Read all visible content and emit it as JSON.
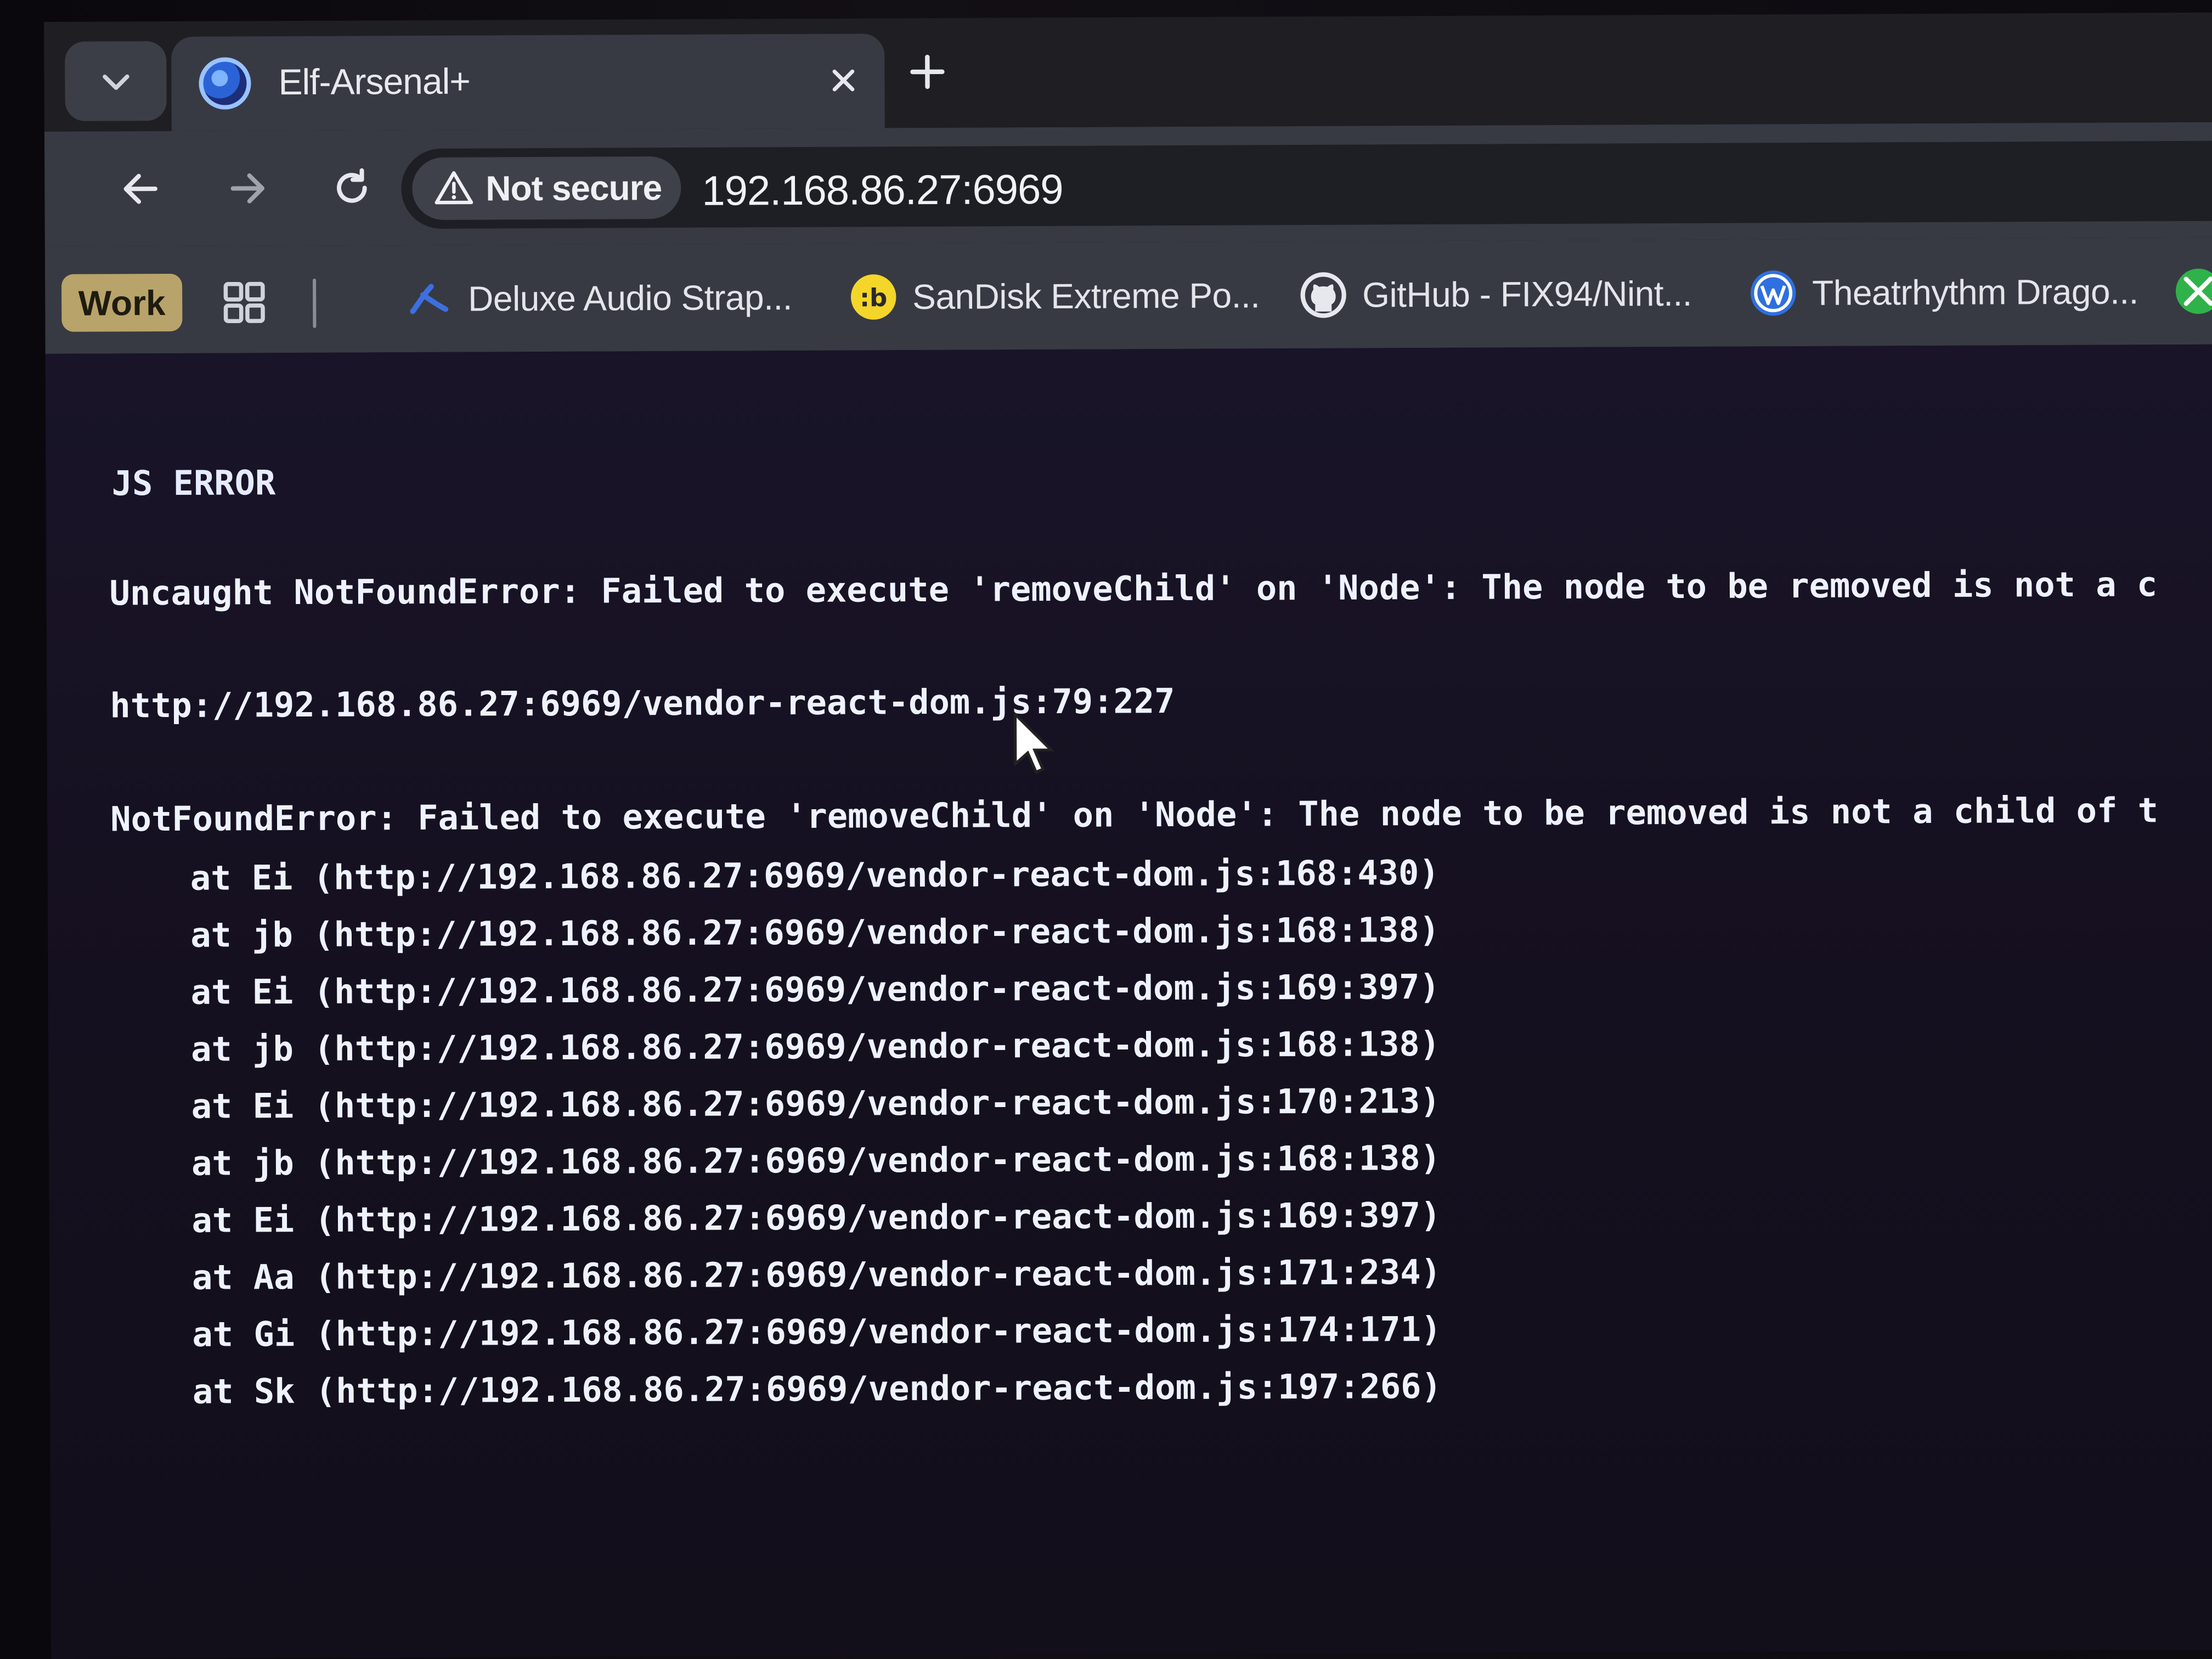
{
  "browser": {
    "tab": {
      "title": "Elf-Arsenal+"
    },
    "address_bar": {
      "security_label": "Not secure",
      "url": "192.168.86.27:6969"
    },
    "bookmarks": {
      "group_label": "Work",
      "items": [
        {
          "label": "Deluxe Audio Strap...",
          "icon": "meta-quest-icon"
        },
        {
          "label": "SanDisk Extreme Po...",
          "icon": "honey-icon"
        },
        {
          "label": "GitHub - FIX94/Nint...",
          "icon": "github-icon"
        },
        {
          "label": "Theatrhythm Drago...",
          "icon": "wordpress-icon"
        }
      ]
    }
  },
  "page": {
    "heading": "JS ERROR",
    "message": "Uncaught NotFoundError: Failed to execute 'removeChild' on 'Node': The node to be removed is not a c",
    "source": "http://192.168.86.27:6969/vendor-react-dom.js:79:227",
    "error_line": "NotFoundError: Failed to execute 'removeChild' on 'Node': The node to be removed is not a child of t",
    "stack": [
      "at Ei (http://192.168.86.27:6969/vendor-react-dom.js:168:430)",
      "at jb (http://192.168.86.27:6969/vendor-react-dom.js:168:138)",
      "at Ei (http://192.168.86.27:6969/vendor-react-dom.js:169:397)",
      "at jb (http://192.168.86.27:6969/vendor-react-dom.js:168:138)",
      "at Ei (http://192.168.86.27:6969/vendor-react-dom.js:170:213)",
      "at jb (http://192.168.86.27:6969/vendor-react-dom.js:168:138)",
      "at Ei (http://192.168.86.27:6969/vendor-react-dom.js:169:397)",
      "at Aa (http://192.168.86.27:6969/vendor-react-dom.js:171:234)",
      "at Gi (http://192.168.86.27:6969/vendor-react-dom.js:174:171)",
      "at Sk (http://192.168.86.27:6969/vendor-react-dom.js:197:266)"
    ]
  },
  "colors": {
    "page_background": "#15101f",
    "text": "#eef2ff",
    "toolbar": "#373a42",
    "bookmark_group": "#b8a46a"
  }
}
